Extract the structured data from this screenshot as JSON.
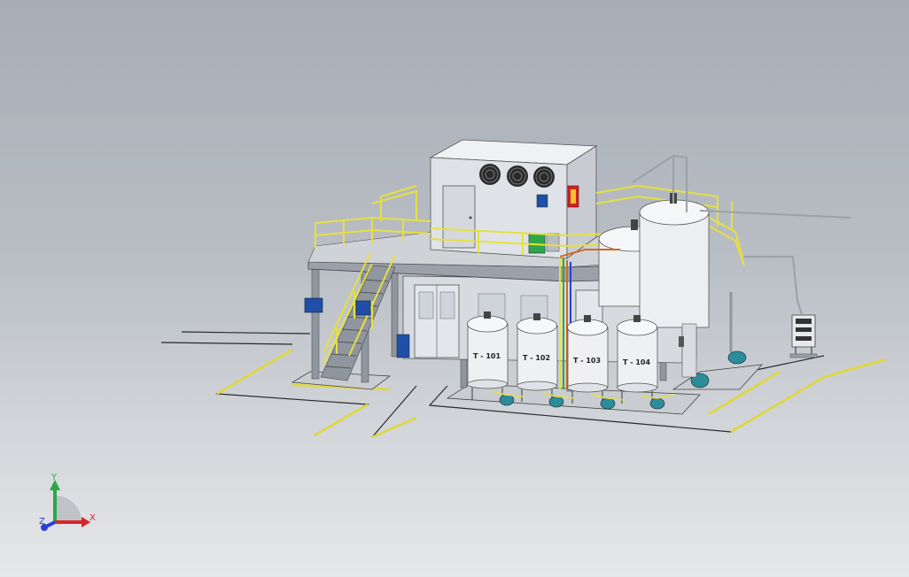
{
  "tanks": [
    {
      "label": "T - 101"
    },
    {
      "label": "T - 102"
    },
    {
      "label": "T - 103"
    },
    {
      "label": "T - 104"
    }
  ],
  "triad": {
    "x_label": "X",
    "y_label": "Y",
    "z_label": "Z",
    "x_color": "#d9232a",
    "y_color": "#2aa84a",
    "z_color": "#2a3fd9"
  },
  "colors": {
    "railing": "#e6e040",
    "steel": "#8f969e",
    "room": "#d7dbe0",
    "floor_line": "#e0d838",
    "pump": "#2d8c9a",
    "panel_blue": "#1f4fa8",
    "extinguisher": "#d22222",
    "green_box": "#2fa84a"
  }
}
